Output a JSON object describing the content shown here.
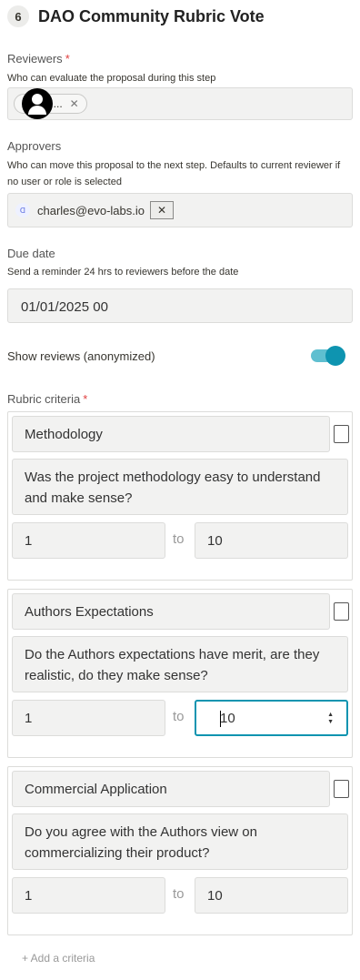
{
  "step": {
    "number": "6",
    "title": "DAO Community Rubric Vote"
  },
  "reviewers": {
    "label": "Reviewers",
    "required_mark": "*",
    "hint": "Who can evaluate the proposal during this step",
    "chip_label": "All ...",
    "chip_remove": "✕"
  },
  "approvers": {
    "label": "Approvers",
    "hint": "Who can move this proposal to the next step. Defaults to current reviewer if no user or role is selected",
    "email": "charles@evo-labs.io",
    "remove": "✕"
  },
  "due_date": {
    "label": "Due date",
    "hint": "Send a reminder 24 hrs to reviewers before the date",
    "value": "01/01/2025 00"
  },
  "show_reviews": {
    "label": "Show reviews (anonymized)",
    "enabled": true
  },
  "rubric": {
    "label": "Rubric criteria",
    "required_mark": "*",
    "to_label": "to",
    "criteria": [
      {
        "name": "Methodology",
        "question_line1": "Was the project methodology easy to understand",
        "question_line2": "and make sense?",
        "min": "1",
        "max": "10"
      },
      {
        "name": "Authors Expectations",
        "question_line1": "Do the Authors expectations have merit, are they",
        "question_line2": "realistic, do they make sense?",
        "min": "1",
        "max": "10"
      },
      {
        "name": "Commercial Application",
        "question_line1": "Do you agree with the Authors view on",
        "question_line2": "commercializing their product?",
        "min": "1",
        "max": "10"
      }
    ],
    "add_label": "+ Add a criteria"
  },
  "colors": {
    "accent": "#0e94b0",
    "required": "#e03e3e"
  }
}
